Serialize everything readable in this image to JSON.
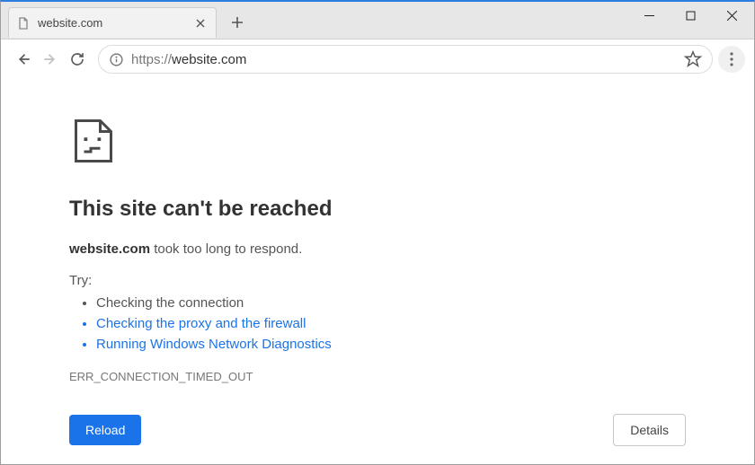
{
  "tab": {
    "title": "website.com"
  },
  "omnibox": {
    "protocol": "https://",
    "host": "website.com"
  },
  "error": {
    "title": "This site can't be reached",
    "desc_host": "website.com",
    "desc_rest": " took too long to respond.",
    "try_label": "Try:",
    "suggestions": [
      {
        "text": "Checking the connection",
        "link": false
      },
      {
        "text": "Checking the proxy and the firewall",
        "link": true
      },
      {
        "text": "Running Windows Network Diagnostics",
        "link": true
      }
    ],
    "code": "ERR_CONNECTION_TIMED_OUT"
  },
  "buttons": {
    "reload": "Reload",
    "details": "Details"
  }
}
